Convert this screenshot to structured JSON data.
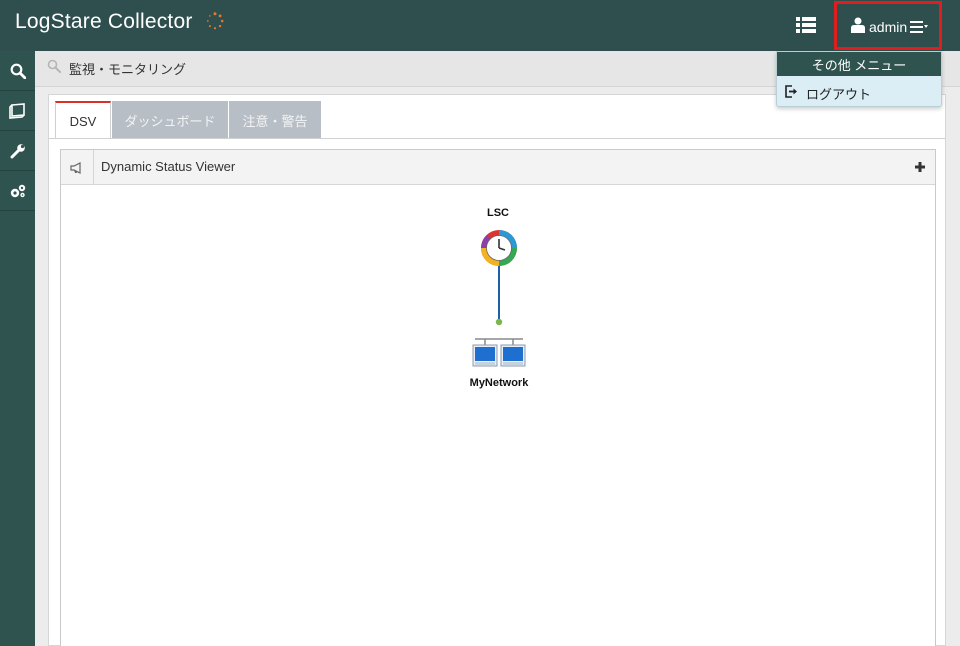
{
  "header": {
    "app_title": "LogStare Collector",
    "user_name": "admin"
  },
  "sidebar": {
    "items": [
      {
        "icon": "search-icon"
      },
      {
        "icon": "book-icon"
      },
      {
        "icon": "wrench-icon"
      },
      {
        "icon": "gears-icon"
      }
    ]
  },
  "searchbar": {
    "breadcrumb": "監視・モニタリング"
  },
  "tabs": [
    {
      "label": "DSV",
      "active": true
    },
    {
      "label": "ダッシュボード",
      "active": false
    },
    {
      "label": "注意・警告",
      "active": false
    }
  ],
  "dsv": {
    "title": "Dynamic Status Viewer",
    "nodes": {
      "lsc_label": "LSC",
      "network_label": "MyNetwork"
    }
  },
  "dropdown": {
    "header": "その他 メニュー",
    "items": [
      {
        "label": "ログアウト",
        "icon": "logout-icon"
      }
    ]
  },
  "colors": {
    "header_bg": "#2f4f4f",
    "accent_red": "#e01e1e",
    "tab_inactive": "#b8bec5",
    "link_blue": "#1f5faa",
    "link_dot_green": "#7ab648"
  }
}
